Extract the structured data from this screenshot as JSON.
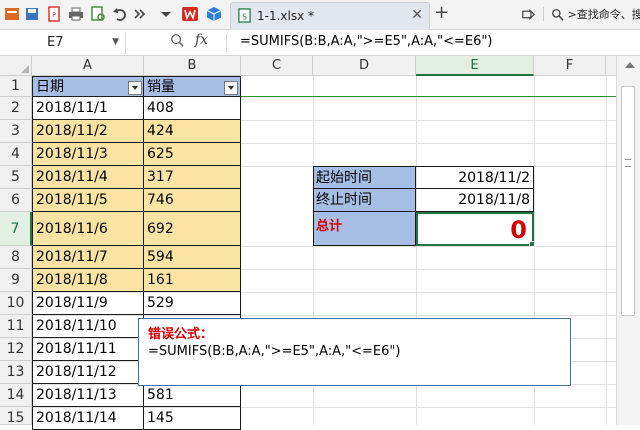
{
  "toolbar": {
    "tab_title": "1-1.xlsx *",
    "tab_close": "✕",
    "add_tab": "+",
    "search_text": ">查找命令、搜"
  },
  "formula_bar": {
    "name_box": "E7",
    "fx": "fx",
    "formula": "=SUMIFS(B:B,A:A,\">=E5\",A:A,\"<=E6\")"
  },
  "columns": [
    "A",
    "B",
    "C",
    "D",
    "E",
    "F"
  ],
  "rows": [
    "1",
    "2",
    "3",
    "4",
    "5",
    "6",
    "7",
    "8",
    "9",
    "10",
    "11",
    "12",
    "13",
    "14",
    "15"
  ],
  "table": {
    "headers": [
      "日期",
      "销量"
    ],
    "dates": [
      "2018/11/1",
      "2018/11/2",
      "2018/11/3",
      "2018/11/4",
      "2018/11/5",
      "2018/11/6",
      "2018/11/7",
      "2018/11/8",
      "2018/11/9",
      "2018/11/10",
      "2018/11/11",
      "2018/11/12",
      "2018/11/13",
      "2018/11/14"
    ],
    "sales": [
      "408",
      "424",
      "625",
      "317",
      "746",
      "692",
      "594",
      "161",
      "529",
      "",
      "",
      "",
      "581",
      "145"
    ]
  },
  "info": {
    "start_label": "起始时间",
    "start_value": "2018/11/2",
    "end_label": "终止时间",
    "end_value": "2018/11/8",
    "total_label": "总计",
    "total_value": "0"
  },
  "callout": {
    "title": "错误公式：",
    "formula": "=SUMIFS(B:B,A:A,\">=E5\",A:A,\"<=E6\")"
  },
  "colors": {
    "header_fill": "#a6bde4",
    "highlight_fill": "#fbe4a3",
    "selection": "#217346",
    "error_red": "#d40000"
  }
}
